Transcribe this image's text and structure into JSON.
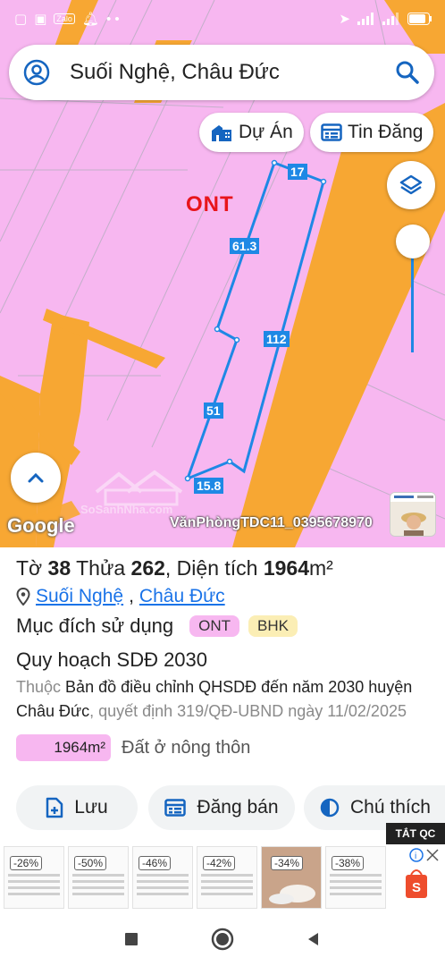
{
  "colors": {
    "zone_pink": "#f7b7f0",
    "road_orange": "#f7a733",
    "plot_line": "#1e88e5",
    "zone_label_red": "#e8141b",
    "link_blue": "#1a73e8"
  },
  "status_bar": {
    "icons": [
      "zalo-icon",
      "notification-icon",
      "location-arrow-icon",
      "signal-icon",
      "battery-icon"
    ],
    "zalo_label": "Zalo"
  },
  "search": {
    "value": "Suối Nghệ, Châu Đức",
    "left_icon": "account-icon",
    "right_icon": "search-icon"
  },
  "chips": {
    "du_an": {
      "label": "Dự Án",
      "icon": "building-icon"
    },
    "tin_dang": {
      "label": "Tin Đăng",
      "icon": "listing-icon"
    }
  },
  "map": {
    "zone_label": "ONT",
    "segments": [
      {
        "label": "17"
      },
      {
        "label": "61.3"
      },
      {
        "label": "112"
      },
      {
        "label": "51"
      },
      {
        "label": "15.8"
      }
    ],
    "google_logo": "Google",
    "watermark": "VănPhòngTDC11_0395678970",
    "ghost_logo": "SoSanhNha.com"
  },
  "parcel": {
    "to_label": "Tờ",
    "to": "38",
    "thua_label": "Thửa",
    "thua": "262",
    "dien_tich_label": ", Diện tích",
    "area": "1964",
    "unit": "m²",
    "location_1": "Suối Nghệ",
    "location_sep": ",",
    "location_2": "Châu Đức",
    "purpose_label": "Mục đích sử dụng",
    "tag_1": "ONT",
    "tag_2": "BHK",
    "plan_title": "Quy hoạch SDĐ 2030",
    "desc_prefix": "Thuộc",
    "desc_dark": "Bản đồ điều chỉnh QHSDĐ đến năm 2030 huyện Châu Đức",
    "desc_suffix": ", quyết định 319/QĐ-UBND ngày 11/02/2025",
    "area_chip": "1964m²",
    "area_desc": "Đất ở nông thôn"
  },
  "actions": {
    "save": "Lưu",
    "sell": "Đăng bán",
    "legend": "Chú thích"
  },
  "ad": {
    "close_label": "TẮT QC",
    "discounts": [
      "-26%",
      "-50%",
      "-46%",
      "-42%",
      "-34%",
      "-38%"
    ]
  }
}
